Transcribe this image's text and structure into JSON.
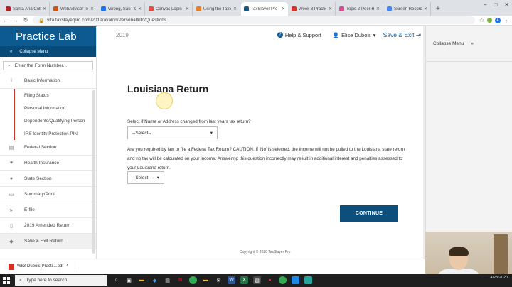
{
  "browser": {
    "tabs": [
      {
        "title": "Santa Ana Coll",
        "color": "#b22222",
        "active": false
      },
      {
        "title": "WebAdvisor fo",
        "color": "#d35400",
        "active": false
      },
      {
        "title": "Wrong, Sau - O",
        "color": "#1a73e8",
        "active": false
      },
      {
        "title": "Canvas Login",
        "color": "#e74c3c",
        "active": false
      },
      {
        "title": "Using the TaxS",
        "color": "#e67e22",
        "active": false
      },
      {
        "title": "TaxSlayer Pro -",
        "color": "#0c5a8f",
        "active": true
      },
      {
        "title": "Week 3 Practic",
        "color": "#d93025",
        "active": false
      },
      {
        "title": "Topic 2-Peer R",
        "color": "#e84393",
        "active": false
      },
      {
        "title": "Screen Record",
        "color": "#4285f4",
        "active": false
      }
    ],
    "url": "vita.taxslayerpro.com/2019/avalon/PersonalInfo/Questions"
  },
  "sidebar": {
    "brand": "Practice Lab",
    "collapse_label": "Collapse Menu",
    "search_placeholder": "Enter the Form Number...",
    "items": [
      {
        "label": "Basic Information",
        "icon": "info-icon",
        "glyph": "i"
      },
      {
        "label": "Federal Section",
        "icon": "bank-icon",
        "glyph": "▤"
      },
      {
        "label": "Health Insurance",
        "icon": "health-icon",
        "glyph": "♥"
      },
      {
        "label": "State Section",
        "icon": "map-pin-icon",
        "glyph": "●"
      },
      {
        "label": "Summary/Print",
        "icon": "print-icon",
        "glyph": "▭"
      },
      {
        "label": "E-file",
        "icon": "send-icon",
        "glyph": "➤"
      },
      {
        "label": "2019 Amended Return",
        "icon": "document-icon",
        "glyph": "▯"
      },
      {
        "label": "Save & Exit Return",
        "icon": "save-icon",
        "glyph": "◆"
      }
    ],
    "subitems": [
      "Filing Status",
      "Personal Information",
      "Dependents/Qualifying Person",
      "IRS Identity Protection PIN"
    ]
  },
  "header": {
    "year": "2019",
    "help_label": "Help & Support",
    "user_name": "Elise Dubois",
    "save_exit_label": "Save & Exit"
  },
  "form": {
    "title": "Louisiana Return",
    "q1": "Select if Name or Address changed from last years tax return?",
    "q1_select": "--Select--",
    "q2": "Are you required by law to file a Federal Tax Return? CAUTION: If 'No' is selected, the income will not be pulled to the Louisiana state return and no tax will be calculated on your income. Answering this question incorrectly may result in additional interest and penalties assessed to your Louisiana return.",
    "q2_select": "--Select--",
    "continue_label": "CONTINUE",
    "footer": "Copyright © 2020 TaxSlayer Pro"
  },
  "right_panel": {
    "collapse_label": "Collapse Menu"
  },
  "downloads": [
    {
      "name": "Wk3-Dubois(Practi....pdf"
    }
  ],
  "taskbar": {
    "search_placeholder": "Type here to search",
    "date": "4/28/2020"
  }
}
